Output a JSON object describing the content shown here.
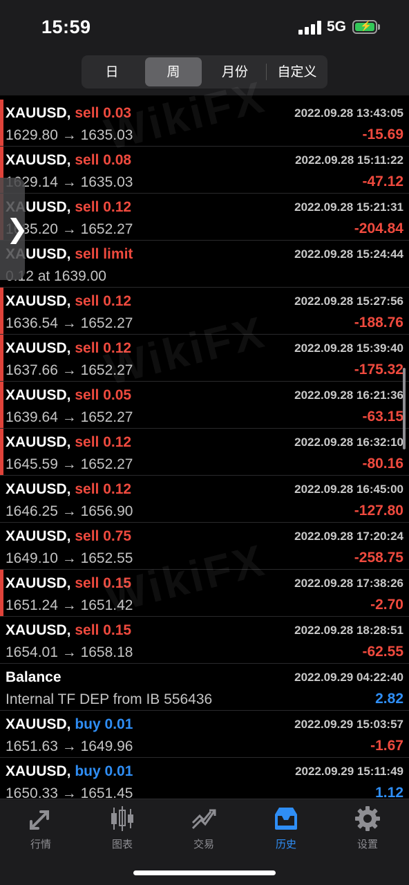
{
  "status_bar": {
    "time": "15:59",
    "network": "5G"
  },
  "period_tabs": [
    {
      "label": "日",
      "active": false
    },
    {
      "label": "周",
      "active": true
    },
    {
      "label": "月份",
      "active": false
    },
    {
      "label": "自定义",
      "active": false
    }
  ],
  "watermark": "WikiFX",
  "rows": [
    {
      "symbol": "XAUUSD,",
      "action": "sell 0.03",
      "side": "sell",
      "datetime": "2022.09.28 13:43:05",
      "prices": "1629.80 → 1635.03",
      "profit": "-15.69",
      "marked": true
    },
    {
      "symbol": "XAUUSD,",
      "action": "sell 0.08",
      "side": "sell",
      "datetime": "2022.09.28 15:11:22",
      "prices": "1629.14 → 1635.03",
      "profit": "-47.12",
      "marked": true
    },
    {
      "symbol": "XAUUSD,",
      "action": "sell 0.12",
      "side": "sell",
      "datetime": "2022.09.28 15:21:31",
      "prices": "1635.20 → 1652.27",
      "profit": "-204.84",
      "marked": true
    },
    {
      "symbol": "XAUUSD,",
      "action": "sell limit",
      "side": "sell",
      "datetime": "2022.09.28 15:24:44",
      "prices": "0.12 at 1639.00",
      "profit": "",
      "marked": false
    },
    {
      "symbol": "XAUUSD,",
      "action": "sell 0.12",
      "side": "sell",
      "datetime": "2022.09.28 15:27:56",
      "prices": "1636.54 → 1652.27",
      "profit": "-188.76",
      "marked": true
    },
    {
      "symbol": "XAUUSD,",
      "action": "sell 0.12",
      "side": "sell",
      "datetime": "2022.09.28 15:39:40",
      "prices": "1637.66 → 1652.27",
      "profit": "-175.32",
      "marked": true
    },
    {
      "symbol": "XAUUSD,",
      "action": "sell 0.05",
      "side": "sell",
      "datetime": "2022.09.28 16:21:36",
      "prices": "1639.64 → 1652.27",
      "profit": "-63.15",
      "marked": true
    },
    {
      "symbol": "XAUUSD,",
      "action": "sell 0.12",
      "side": "sell",
      "datetime": "2022.09.28 16:32:10",
      "prices": "1645.59 → 1652.27",
      "profit": "-80.16",
      "marked": true
    },
    {
      "symbol": "XAUUSD,",
      "action": "sell 0.12",
      "side": "sell",
      "datetime": "2022.09.28 16:45:00",
      "prices": "1646.25 → 1656.90",
      "profit": "-127.80",
      "marked": false
    },
    {
      "symbol": "XAUUSD,",
      "action": "sell 0.75",
      "side": "sell",
      "datetime": "2022.09.28 17:20:24",
      "prices": "1649.10 → 1652.55",
      "profit": "-258.75",
      "marked": false
    },
    {
      "symbol": "XAUUSD,",
      "action": "sell 0.15",
      "side": "sell",
      "datetime": "2022.09.28 17:38:26",
      "prices": "1651.24 → 1651.42",
      "profit": "-2.70",
      "marked": true
    },
    {
      "symbol": "XAUUSD,",
      "action": "sell 0.15",
      "side": "sell",
      "datetime": "2022.09.28 18:28:51",
      "prices": "1654.01 → 1658.18",
      "profit": "-62.55",
      "marked": false
    },
    {
      "symbol": "Balance",
      "action": "",
      "side": "",
      "datetime": "2022.09.29 04:22:40",
      "prices": "Internal TF DEP from IB 556436",
      "profit": "2.82",
      "marked": false
    },
    {
      "symbol": "XAUUSD,",
      "action": "buy 0.01",
      "side": "buy",
      "datetime": "2022.09.29 15:03:57",
      "prices": "1651.63 → 1649.96",
      "profit": "-1.67",
      "marked": false
    },
    {
      "symbol": "XAUUSD,",
      "action": "buy 0.01",
      "side": "buy",
      "datetime": "2022.09.29 15:11:49",
      "prices": "1650.33 → 1651.45",
      "profit": "1.12",
      "marked": false
    }
  ],
  "bottom_tabs": [
    {
      "label": "行情",
      "icon": "quotes-arrows-icon",
      "active": false
    },
    {
      "label": "图表",
      "icon": "candlestick-chart-icon",
      "active": false
    },
    {
      "label": "交易",
      "icon": "trade-trend-icon",
      "active": false
    },
    {
      "label": "历史",
      "icon": "history-inbox-icon",
      "active": true
    },
    {
      "label": "设置",
      "icon": "gear-icon",
      "active": false
    }
  ],
  "colors": {
    "sell": "#ef4a3e",
    "buy": "#2f8ef5",
    "accent": "#2f8ef5",
    "marker": "#e0433a"
  }
}
